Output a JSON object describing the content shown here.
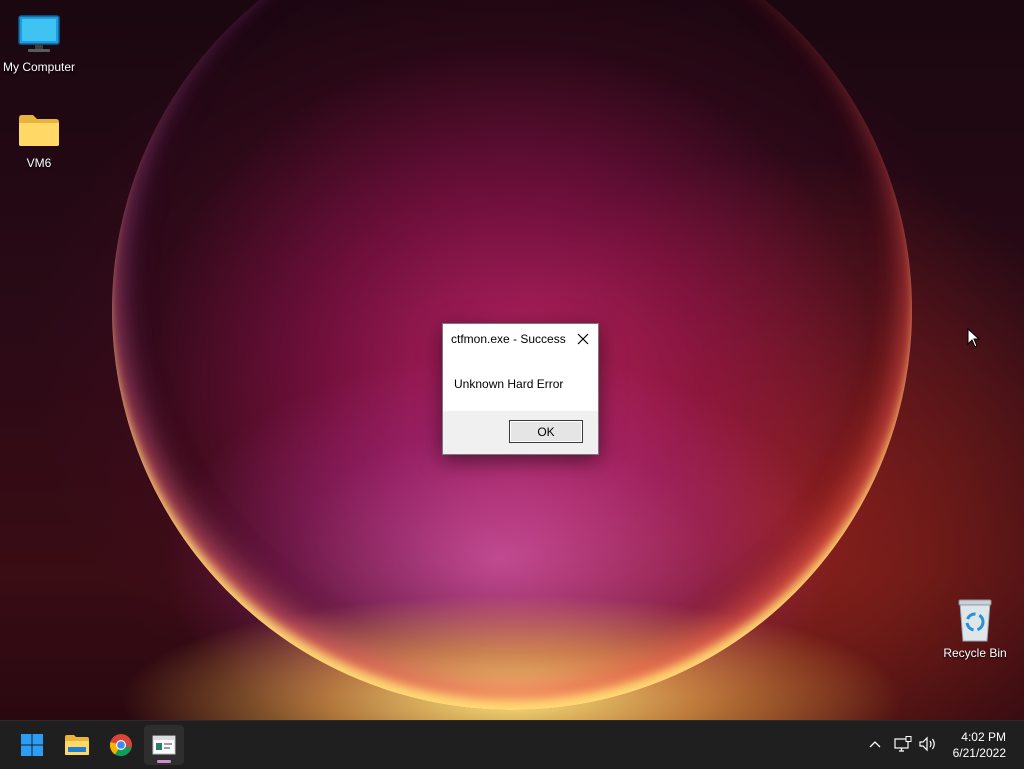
{
  "desktop": {
    "icons": [
      {
        "label": "My Computer",
        "icon": "monitor-icon"
      },
      {
        "label": "VM6",
        "icon": "folder-icon"
      },
      {
        "label": "Recycle Bin",
        "icon": "recycle-bin-icon"
      }
    ]
  },
  "dialog": {
    "title": "ctfmon.exe - Success",
    "message": "Unknown Hard Error",
    "ok_label": "OK"
  },
  "taskbar": {
    "apps": [
      {
        "name": "Start",
        "icon": "windows-start-icon"
      },
      {
        "name": "File Explorer",
        "icon": "file-explorer-icon"
      },
      {
        "name": "Google Chrome",
        "icon": "chrome-icon"
      },
      {
        "name": "Active Window",
        "icon": "app-window-icon"
      }
    ],
    "tray": {
      "time": "4:02 PM",
      "date": "6/21/2022"
    }
  },
  "colors": {
    "taskbar_bg": "#1f1f1f",
    "active_indicator": "#d48bd0",
    "dialog_footer": "#f0f0f0"
  }
}
